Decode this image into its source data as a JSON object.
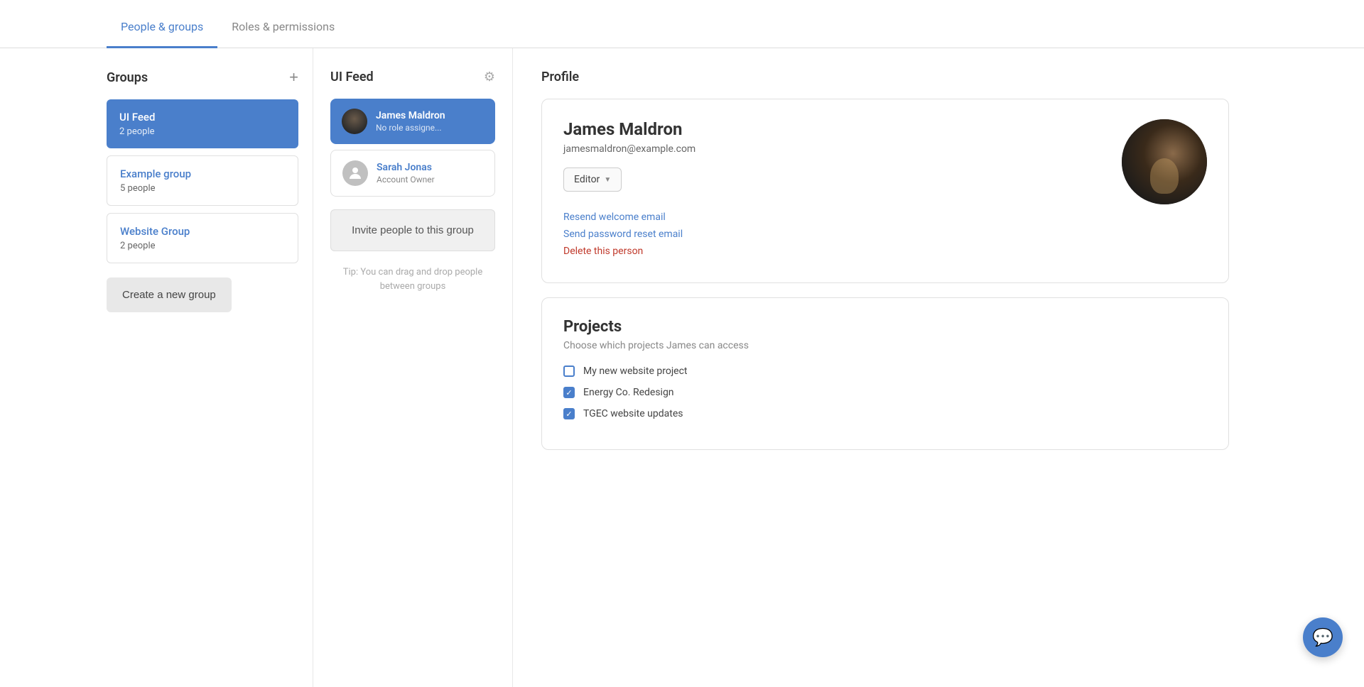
{
  "tabs": [
    {
      "id": "people-groups",
      "label": "People & groups",
      "active": true
    },
    {
      "id": "roles-permissions",
      "label": "Roles & permissions",
      "active": false
    }
  ],
  "groups_column": {
    "title": "Groups",
    "add_btn_label": "+",
    "groups": [
      {
        "id": "ui-feed",
        "name": "UI Feed",
        "count": "2 people",
        "active": true
      },
      {
        "id": "example-group",
        "name": "Example group",
        "count": "5 people",
        "active": false
      },
      {
        "id": "website-group",
        "name": "Website Group",
        "count": "2 people",
        "active": false
      }
    ],
    "create_btn_label": "Create a new group"
  },
  "members_column": {
    "title": "UI Feed",
    "members": [
      {
        "id": "james-maldron",
        "name": "James Maldron",
        "role": "No role assigne...",
        "selected": true,
        "has_photo": true
      },
      {
        "id": "sarah-jonas",
        "name": "Sarah Jonas",
        "role": "Account Owner",
        "selected": false,
        "has_photo": false
      }
    ],
    "invite_btn_label": "Invite people to this group",
    "tip_text": "Tip: You can drag and drop people between groups"
  },
  "profile_column": {
    "title": "Profile",
    "name": "James Maldron",
    "email": "jamesmaldron@example.com",
    "role": "Editor",
    "actions": [
      {
        "id": "resend-email",
        "label": "Resend welcome email",
        "type": "primary"
      },
      {
        "id": "reset-password",
        "label": "Send password reset email",
        "type": "primary"
      },
      {
        "id": "delete-person",
        "label": "Delete this person",
        "type": "danger"
      }
    ],
    "projects": {
      "title": "Projects",
      "subtitle_prefix": "Choose which projects",
      "subtitle_name": "James",
      "subtitle_suffix": "can access",
      "items": [
        {
          "id": "my-new-website",
          "name": "My new website project",
          "checked": false
        },
        {
          "id": "energy-co-redesign",
          "name": "Energy Co. Redesign",
          "checked": true
        },
        {
          "id": "tgec-website-updates",
          "name": "TGEC website updates",
          "checked": true
        }
      ]
    }
  }
}
